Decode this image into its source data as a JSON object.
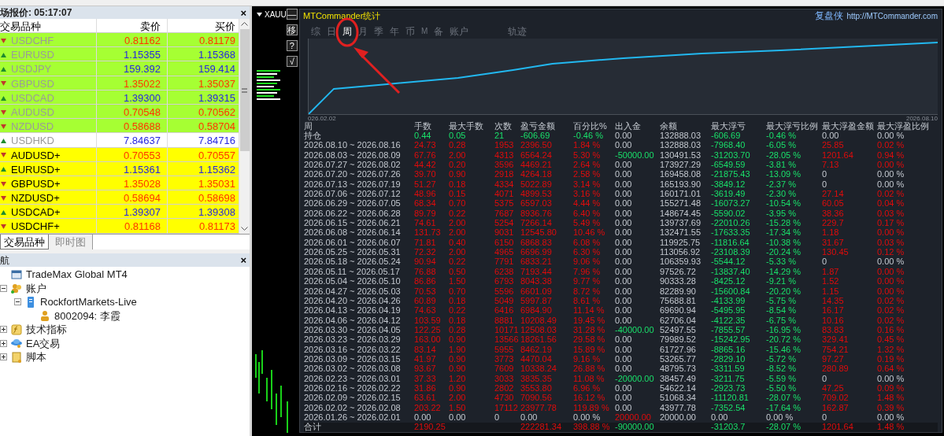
{
  "market_watch": {
    "title": "场报价: 05:17:07",
    "close": "×",
    "columns": [
      "交易品种",
      "卖价",
      "买价"
    ],
    "rows": [
      {
        "symbol": "USDCHF",
        "bid": "0.81162",
        "ask": "0.81179",
        "up": false,
        "disabled": true,
        "color": "#a6ff33"
      },
      {
        "symbol": "EURUSD",
        "bid": "1.15355",
        "ask": "1.15368",
        "up": true,
        "disabled": true,
        "color": "#a6ff33"
      },
      {
        "symbol": "USDJPY",
        "bid": "159.392",
        "ask": "159.414",
        "up": true,
        "disabled": true,
        "color": "#a6ff33"
      },
      {
        "symbol": "GBPUSD",
        "bid": "1.35022",
        "ask": "1.35037",
        "up": false,
        "disabled": true,
        "color": "#a6ff33"
      },
      {
        "symbol": "USDCAD",
        "bid": "1.39300",
        "ask": "1.39315",
        "up": true,
        "disabled": true,
        "color": "#a6ff33"
      },
      {
        "symbol": "AUDUSD",
        "bid": "0.70548",
        "ask": "0.70562",
        "up": false,
        "disabled": true,
        "color": "#a6ff33"
      },
      {
        "symbol": "NZDUSD",
        "bid": "0.58688",
        "ask": "0.58704",
        "up": false,
        "disabled": true,
        "color": "#a6ff33"
      },
      {
        "symbol": "USDHKD",
        "bid": "7.84637",
        "ask": "7.84716",
        "up": true,
        "disabled": true,
        "color": "#ffffff"
      },
      {
        "symbol": "AUDUSD+",
        "bid": "0.70553",
        "ask": "0.70557",
        "up": false,
        "disabled": false,
        "color": "#ffff00"
      },
      {
        "symbol": "EURUSD+",
        "bid": "1.15361",
        "ask": "1.15362",
        "up": true,
        "disabled": false,
        "color": "#ffff00"
      },
      {
        "symbol": "GBPUSD+",
        "bid": "1.35028",
        "ask": "1.35031",
        "up": false,
        "disabled": false,
        "color": "#ffff00"
      },
      {
        "symbol": "NZDUSD+",
        "bid": "0.58694",
        "ask": "0.58698",
        "up": false,
        "disabled": false,
        "color": "#ffff00"
      },
      {
        "symbol": "USDCAD+",
        "bid": "1.39307",
        "ask": "1.39308",
        "up": true,
        "disabled": false,
        "color": "#ffff00"
      },
      {
        "symbol": "USDCHF+",
        "bid": "0.81168",
        "ask": "0.81173",
        "up": false,
        "disabled": false,
        "color": "#ffff00"
      }
    ],
    "tabs": [
      {
        "label": "交易品种",
        "selected": true
      },
      {
        "label": "即时图",
        "selected": false
      }
    ]
  },
  "navigator": {
    "title": "航",
    "close": "×",
    "items": [
      {
        "label": "TradeMax Global MT4",
        "kind": "terminal"
      },
      {
        "label": "账户",
        "kind": "accounts",
        "expanded": true,
        "children": [
          {
            "label": "RockfortMarkets-Live",
            "kind": "server",
            "expanded": true,
            "children": [
              {
                "label": "8002094: 李霞",
                "kind": "account"
              }
            ]
          }
        ]
      },
      {
        "label": "技术指标",
        "kind": "indicators",
        "expanded": false
      },
      {
        "label": "EA交易",
        "kind": "experts",
        "expanded": false
      },
      {
        "label": "脚本",
        "kind": "scripts",
        "expanded": false
      }
    ]
  },
  "chart_window": {
    "symbol": "XAUU",
    "buttons": [
      "—",
      "移",
      "?",
      "√"
    ]
  },
  "stats": {
    "title": "MTCommander统计",
    "brand": "复盘侠",
    "url": "http://MTCommander.com",
    "tabs": [
      {
        "label": "综",
        "selected": false
      },
      {
        "label": "日",
        "selected": false
      },
      {
        "label": "周",
        "selected": true
      },
      {
        "label": "月",
        "selected": false
      },
      {
        "label": "季",
        "selected": false
      },
      {
        "label": "年",
        "selected": false
      },
      {
        "label": "币",
        "selected": false
      },
      {
        "label": "M",
        "selected": false
      },
      {
        "label": "备",
        "selected": false
      },
      {
        "label": "账户",
        "selected": false
      },
      {
        "label": "轨迹",
        "selected": false
      }
    ],
    "curve": {
      "start_label": "026.02.02",
      "end_label": "2026.08.10"
    },
    "columns": [
      "周",
      "手数",
      "最大手数",
      "次数",
      "盈亏金额",
      "百分比%",
      "出入金",
      "余额",
      "最大浮亏",
      "最大浮亏比例",
      "最大浮盈金额",
      "最大浮盈比例"
    ],
    "holding": {
      "label": "持仓",
      "groups": [
        {
          "values": [
            "0.44",
            "0.05",
            "21",
            "-606.69",
            "-0.46 %"
          ],
          "gain": false
        },
        {
          "values": [
            "0.00"
          ]
        },
        {
          "values": [
            "132888.03"
          ]
        },
        {
          "values": [
            "-606.69",
            "-0.46 %"
          ],
          "gain": false
        },
        {
          "values": [
            "0.00",
            "0.00 %"
          ]
        }
      ]
    },
    "rows": [
      {
        "period": "2026.08.10 ~ 2026.08.16",
        "groups": [
          {
            "values": [
              "24.73",
              "0.28",
              "1953",
              "2396.50",
              "1.84 %"
            ],
            "gain": true
          },
          {
            "values": [
              "0.00"
            ]
          },
          {
            "values": [
              "132888.03"
            ]
          },
          {
            "values": [
              "-7968.40",
              "-6.05 %"
            ],
            "gain": false
          },
          {
            "values": [
              "25.85",
              "0.02 %"
            ],
            "gain": true
          }
        ]
      },
      {
        "period": "2026.08.03 ~ 2026.08.09",
        "groups": [
          {
            "values": [
              "67.76",
              "2.00",
              "4313",
              "6564.24",
              "5.30 %"
            ],
            "gain": true
          },
          {
            "values": [
              "-50000.00"
            ],
            "gain": false
          },
          {
            "values": [
              "130491.53"
            ]
          },
          {
            "values": [
              "-31203.70",
              "-28.05 %"
            ],
            "gain": false
          },
          {
            "values": [
              "1201.64",
              "0.94 %"
            ],
            "gain": true
          }
        ]
      },
      {
        "period": "2026.07.27 ~ 2026.08.02",
        "groups": [
          {
            "values": [
              "44.42",
              "0.20",
              "3596",
              "4469.21",
              "2.64 %"
            ],
            "gain": true
          },
          {
            "values": [
              "0.00"
            ]
          },
          {
            "values": [
              "173927.29"
            ]
          },
          {
            "values": [
              "-6549.59",
              "-3.81 %"
            ],
            "gain": false
          },
          {
            "values": [
              "7.13",
              "0.00 %"
            ],
            "gain": true
          }
        ]
      },
      {
        "period": "2026.07.20 ~ 2026.07.26",
        "groups": [
          {
            "values": [
              "39.70",
              "0.90",
              "2918",
              "4264.18",
              "2.58 %"
            ],
            "gain": true
          },
          {
            "values": [
              "0.00"
            ]
          },
          {
            "values": [
              "169458.08"
            ]
          },
          {
            "values": [
              "-21875.43",
              "-13.09 %"
            ],
            "gain": false
          },
          {
            "values": [
              "0",
              "0.00 %"
            ]
          }
        ]
      },
      {
        "period": "2026.07.13 ~ 2026.07.19",
        "groups": [
          {
            "values": [
              "51.27",
              "0.18",
              "4334",
              "5022.89",
              "3.14 %"
            ],
            "gain": true
          },
          {
            "values": [
              "0.00"
            ]
          },
          {
            "values": [
              "165193.90"
            ]
          },
          {
            "values": [
              "-3849.12",
              "-2.37 %"
            ],
            "gain": false
          },
          {
            "values": [
              "0",
              "0.00 %"
            ]
          }
        ]
      },
      {
        "period": "2026.07.06 ~ 2026.07.12",
        "groups": [
          {
            "values": [
              "48.96",
              "0.15",
              "4071",
              "4899.53",
              "3.16 %"
            ],
            "gain": true
          },
          {
            "values": [
              "0.00"
            ]
          },
          {
            "values": [
              "160171.01"
            ]
          },
          {
            "values": [
              "-3619.49",
              "-2.30 %"
            ],
            "gain": false
          },
          {
            "values": [
              "27.14",
              "0.02 %"
            ],
            "gain": true
          }
        ]
      },
      {
        "period": "2026.06.29 ~ 2026.07.05",
        "groups": [
          {
            "values": [
              "68.34",
              "0.70",
              "5375",
              "6597.03",
              "4.44 %"
            ],
            "gain": true
          },
          {
            "values": [
              "0.00"
            ]
          },
          {
            "values": [
              "155271.48"
            ]
          },
          {
            "values": [
              "-16073.27",
              "-10.54 %"
            ],
            "gain": false
          },
          {
            "values": [
              "60.05",
              "0.04 %"
            ],
            "gain": true
          }
        ]
      },
      {
        "period": "2026.06.22 ~ 2026.06.28",
        "groups": [
          {
            "values": [
              "89.79",
              "0.22",
              "7687",
              "8936.76",
              "6.40 %"
            ],
            "gain": true
          },
          {
            "values": [
              "0.00"
            ]
          },
          {
            "values": [
              "148674.45"
            ]
          },
          {
            "values": [
              "-5590.02",
              "-3.95 %"
            ],
            "gain": false
          },
          {
            "values": [
              "38.36",
              "0.03 %"
            ],
            "gain": true
          }
        ]
      },
      {
        "period": "2026.06.15 ~ 2026.06.21",
        "groups": [
          {
            "values": [
              "74.61",
              "2.00",
              "5254",
              "7266.14",
              "5.49 %"
            ],
            "gain": true
          },
          {
            "values": [
              "0.00"
            ]
          },
          {
            "values": [
              "139737.69"
            ]
          },
          {
            "values": [
              "-22010.26",
              "-15.28 %"
            ],
            "gain": false
          },
          {
            "values": [
              "229.7",
              "0.17 %"
            ],
            "gain": true
          }
        ]
      },
      {
        "period": "2026.06.08 ~ 2026.06.14",
        "groups": [
          {
            "values": [
              "131.73",
              "2.00",
              "9031",
              "12545.80",
              "10.46 %"
            ],
            "gain": true
          },
          {
            "values": [
              "0.00"
            ]
          },
          {
            "values": [
              "132471.55"
            ]
          },
          {
            "values": [
              "-17633.35",
              "-17.34 %"
            ],
            "gain": false
          },
          {
            "values": [
              "1.18",
              "0.00 %"
            ],
            "gain": true
          }
        ]
      },
      {
        "period": "2026.06.01 ~ 2026.06.07",
        "groups": [
          {
            "values": [
              "71.81",
              "0.40",
              "6150",
              "6868.83",
              "6.08 %"
            ],
            "gain": true
          },
          {
            "values": [
              "0.00"
            ]
          },
          {
            "values": [
              "119925.75"
            ]
          },
          {
            "values": [
              "-11816.64",
              "-10.38 %"
            ],
            "gain": false
          },
          {
            "values": [
              "31.67",
              "0.03 %"
            ],
            "gain": true
          }
        ]
      },
      {
        "period": "2026.05.25 ~ 2026.05.31",
        "groups": [
          {
            "values": [
              "72.32",
              "2.00",
              "4965",
              "6696.99",
              "6.30 %"
            ],
            "gain": true
          },
          {
            "values": [
              "0.00"
            ]
          },
          {
            "values": [
              "113056.92"
            ]
          },
          {
            "values": [
              "-23108.39",
              "-20.24 %"
            ],
            "gain": false
          },
          {
            "values": [
              "130.45",
              "0.12 %"
            ],
            "gain": true
          }
        ]
      },
      {
        "period": "2026.05.18 ~ 2026.05.24",
        "groups": [
          {
            "values": [
              "90.94",
              "0.22",
              "7791",
              "6833.21",
              "9.06 %"
            ],
            "gain": true
          },
          {
            "values": [
              "0.00"
            ]
          },
          {
            "values": [
              "106359.93"
            ]
          },
          {
            "values": [
              "-5544.12",
              "-5.33 %"
            ],
            "gain": false
          },
          {
            "values": [
              "0",
              "0.00 %"
            ]
          }
        ]
      },
      {
        "period": "2026.05.11 ~ 2026.05.17",
        "groups": [
          {
            "values": [
              "76.88",
              "0.50",
              "6238",
              "7193.44",
              "7.96 %"
            ],
            "gain": true
          },
          {
            "values": [
              "0.00"
            ]
          },
          {
            "values": [
              "97526.72"
            ]
          },
          {
            "values": [
              "-13837.40",
              "-14.29 %"
            ],
            "gain": false
          },
          {
            "values": [
              "1.87",
              "0.00 %"
            ],
            "gain": true
          }
        ]
      },
      {
        "period": "2026.05.04 ~ 2026.05.10",
        "groups": [
          {
            "values": [
              "86.86",
              "1.50",
              "6793",
              "8043.38",
              "9.77 %"
            ],
            "gain": true
          },
          {
            "values": [
              "0.00"
            ]
          },
          {
            "values": [
              "90333.28"
            ]
          },
          {
            "values": [
              "-8425.12",
              "-9.21 %"
            ],
            "gain": false
          },
          {
            "values": [
              "1.52",
              "0.00 %"
            ],
            "gain": true
          }
        ]
      },
      {
        "period": "2026.04.27 ~ 2026.05.03",
        "groups": [
          {
            "values": [
              "70.53",
              "0.70",
              "5596",
              "6601.09",
              "8.72 %"
            ],
            "gain": true
          },
          {
            "values": [
              "0.00"
            ]
          },
          {
            "values": [
              "82289.90"
            ]
          },
          {
            "values": [
              "-15600.84",
              "-20.20 %"
            ],
            "gain": false
          },
          {
            "values": [
              "1.15",
              "0.00 %"
            ],
            "gain": true
          }
        ]
      },
      {
        "period": "2026.04.20 ~ 2026.04.26",
        "groups": [
          {
            "values": [
              "60.89",
              "0.18",
              "5049",
              "5997.87",
              "8.61 %"
            ],
            "gain": true
          },
          {
            "values": [
              "0.00"
            ]
          },
          {
            "values": [
              "75688.81"
            ]
          },
          {
            "values": [
              "-4133.99",
              "-5.75 %"
            ],
            "gain": false
          },
          {
            "values": [
              "14.35",
              "0.02 %"
            ],
            "gain": true
          }
        ]
      },
      {
        "period": "2026.04.13 ~ 2026.04.19",
        "groups": [
          {
            "values": [
              "74.63",
              "0.22",
              "6416",
              "6984.90",
              "11.14 %"
            ],
            "gain": true
          },
          {
            "values": [
              "0.00"
            ]
          },
          {
            "values": [
              "69690.94"
            ]
          },
          {
            "values": [
              "-5495.95",
              "-8.54 %"
            ],
            "gain": false
          },
          {
            "values": [
              "16.17",
              "0.02 %"
            ],
            "gain": true
          }
        ]
      },
      {
        "period": "2026.04.06 ~ 2026.04.12",
        "groups": [
          {
            "values": [
              "103.59",
              "0.18",
              "8881",
              "10208.49",
              "19.45 %"
            ],
            "gain": true
          },
          {
            "values": [
              "0.00"
            ]
          },
          {
            "values": [
              "62706.04"
            ]
          },
          {
            "values": [
              "-4122.35",
              "-6.75 %"
            ],
            "gain": false
          },
          {
            "values": [
              "10.16",
              "0.02 %"
            ],
            "gain": true
          }
        ]
      },
      {
        "period": "2026.03.30 ~ 2026.04.05",
        "groups": [
          {
            "values": [
              "122.25",
              "0.28",
              "10171",
              "12508.03",
              "31.28 %"
            ],
            "gain": true
          },
          {
            "values": [
              "-40000.00"
            ],
            "gain": false
          },
          {
            "values": [
              "52497.55"
            ]
          },
          {
            "values": [
              "-7855.57",
              "-16.95 %"
            ],
            "gain": false
          },
          {
            "values": [
              "83.83",
              "0.16 %"
            ],
            "gain": true
          }
        ]
      },
      {
        "period": "2026.03.23 ~ 2026.03.29",
        "groups": [
          {
            "values": [
              "163.00",
              "0.90",
              "13566",
              "18261.56",
              "29.58 %"
            ],
            "gain": true
          },
          {
            "values": [
              "0.00"
            ]
          },
          {
            "values": [
              "79989.52"
            ]
          },
          {
            "values": [
              "-15242.95",
              "-20.72 %"
            ],
            "gain": false
          },
          {
            "values": [
              "329.41",
              "0.45 %"
            ],
            "gain": true
          }
        ]
      },
      {
        "period": "2026.03.16 ~ 2026.03.22",
        "groups": [
          {
            "values": [
              "83.14",
              "1.90",
              "5955",
              "8462.19",
              "15.89 %"
            ],
            "gain": true
          },
          {
            "values": [
              "0.00"
            ]
          },
          {
            "values": [
              "61727.96"
            ]
          },
          {
            "values": [
              "-8865.16",
              "-15.46 %"
            ],
            "gain": false
          },
          {
            "values": [
              "754.21",
              "1.32 %"
            ],
            "gain": true
          }
        ]
      },
      {
        "period": "2026.03.09 ~ 2026.03.15",
        "groups": [
          {
            "values": [
              "41.97",
              "0.90",
              "3773",
              "4470.04",
              "9.16 %"
            ],
            "gain": true
          },
          {
            "values": [
              "0.00"
            ]
          },
          {
            "values": [
              "53265.77"
            ]
          },
          {
            "values": [
              "-2829.10",
              "-5.72 %"
            ],
            "gain": false
          },
          {
            "values": [
              "97.27",
              "0.19 %"
            ],
            "gain": true
          }
        ]
      },
      {
        "period": "2026.03.02 ~ 2026.03.08",
        "groups": [
          {
            "values": [
              "93.67",
              "0.90",
              "7609",
              "10338.24",
              "26.88 %"
            ],
            "gain": true
          },
          {
            "values": [
              "0.00"
            ]
          },
          {
            "values": [
              "48795.73"
            ]
          },
          {
            "values": [
              "-3311.59",
              "-8.52 %"
            ],
            "gain": false
          },
          {
            "values": [
              "280.89",
              "0.64 %"
            ],
            "gain": true
          }
        ]
      },
      {
        "period": "2026.02.23 ~ 2026.03.01",
        "groups": [
          {
            "values": [
              "37.33",
              "1.20",
              "3033",
              "3835.35",
              "11.08 %"
            ],
            "gain": true
          },
          {
            "values": [
              "-20000.00"
            ],
            "gain": false
          },
          {
            "values": [
              "38457.49"
            ]
          },
          {
            "values": [
              "-3211.75",
              "-5.59 %"
            ],
            "gain": false
          },
          {
            "values": [
              "0",
              "0.00 %"
            ]
          }
        ]
      },
      {
        "period": "2026.02.16 ~ 2026.02.22",
        "groups": [
          {
            "values": [
              "31.86",
              "0.90",
              "2802",
              "3553.80",
              "6.96 %"
            ],
            "gain": true
          },
          {
            "values": [
              "0.00"
            ]
          },
          {
            "values": [
              "54622.14"
            ]
          },
          {
            "values": [
              "-2923.73",
              "-5.50 %"
            ],
            "gain": false
          },
          {
            "values": [
              "47.25",
              "0.09 %"
            ],
            "gain": true
          }
        ]
      },
      {
        "period": "2026.02.09 ~ 2026.02.15",
        "groups": [
          {
            "values": [
              "63.61",
              "2.00",
              "4730",
              "7090.56",
              "16.12 %"
            ],
            "gain": true
          },
          {
            "values": [
              "0.00"
            ]
          },
          {
            "values": [
              "51068.34"
            ]
          },
          {
            "values": [
              "-11120.81",
              "-28.07 %"
            ],
            "gain": false
          },
          {
            "values": [
              "709.02",
              "1.48 %"
            ],
            "gain": true
          }
        ]
      },
      {
        "period": "2026.02.02 ~ 2026.02.08",
        "groups": [
          {
            "values": [
              "203.22",
              "1.50",
              "17112",
              "23977.78",
              "119.89 %"
            ],
            "gain": true
          },
          {
            "values": [
              "0.00"
            ]
          },
          {
            "values": [
              "43977.78"
            ]
          },
          {
            "values": [
              "-7352.54",
              "-17.64 %"
            ],
            "gain": false
          },
          {
            "values": [
              "162.87",
              "0.39 %"
            ],
            "gain": true
          }
        ]
      },
      {
        "period": "2026.01.26 ~ 2026.02.01",
        "groups": [
          {
            "values": [
              "0.00",
              "0.00",
              "0",
              "0.00",
              "0.00 %"
            ]
          },
          {
            "values": [
              "20000.00"
            ],
            "gain": true
          },
          {
            "values": [
              "20000.00"
            ]
          },
          {
            "values": [
              "0.00",
              "0.00 %"
            ]
          },
          {
            "values": [
              "0",
              "0.00 %"
            ]
          }
        ]
      }
    ],
    "total": {
      "label": "合计",
      "cells": [
        {
          "kind": "lots",
          "text": "2190.25",
          "gain": true
        },
        {
          "kind": "profit",
          "text": "222281.34",
          "gain": true
        },
        {
          "kind": "percent",
          "text": "398.88 %",
          "gain": true
        },
        {
          "kind": "deposit",
          "text": "-90000.00",
          "gain": false
        },
        {
          "kind": "drawdown",
          "text": "-31203.7",
          "gain": false
        },
        {
          "kind": "drawdown_ratio",
          "text": "-28.07 %",
          "gain": false
        },
        {
          "kind": "float_profit",
          "text": "1201.64",
          "gain": true
        },
        {
          "kind": "float_ratio",
          "text": "1.48 %",
          "gain": true
        }
      ]
    }
  }
}
